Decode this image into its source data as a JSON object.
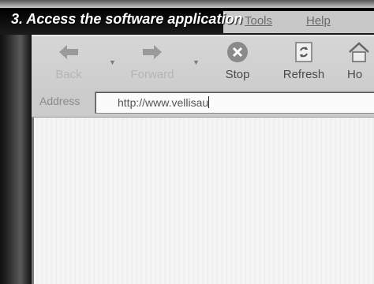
{
  "caption": "3. Access the software application",
  "menu": {
    "items": [
      "Tools",
      "Help"
    ]
  },
  "toolbar": {
    "back_label": "Back",
    "forward_label": "Forward",
    "stop_label": "Stop",
    "refresh_label": "Refresh",
    "home_label": "Ho",
    "back_icon": "left-arrow-icon",
    "forward_icon": "right-arrow-icon",
    "stop_icon": "stop-icon",
    "refresh_icon": "refresh-icon",
    "home_icon": "home-icon"
  },
  "address": {
    "label": "Address",
    "value": "http://www.vellisau"
  },
  "colors": {
    "caption_text": "#ffffff",
    "toolbar_bg": "#d0d0d0",
    "stop_icon_bg": "#8a8a8a"
  }
}
